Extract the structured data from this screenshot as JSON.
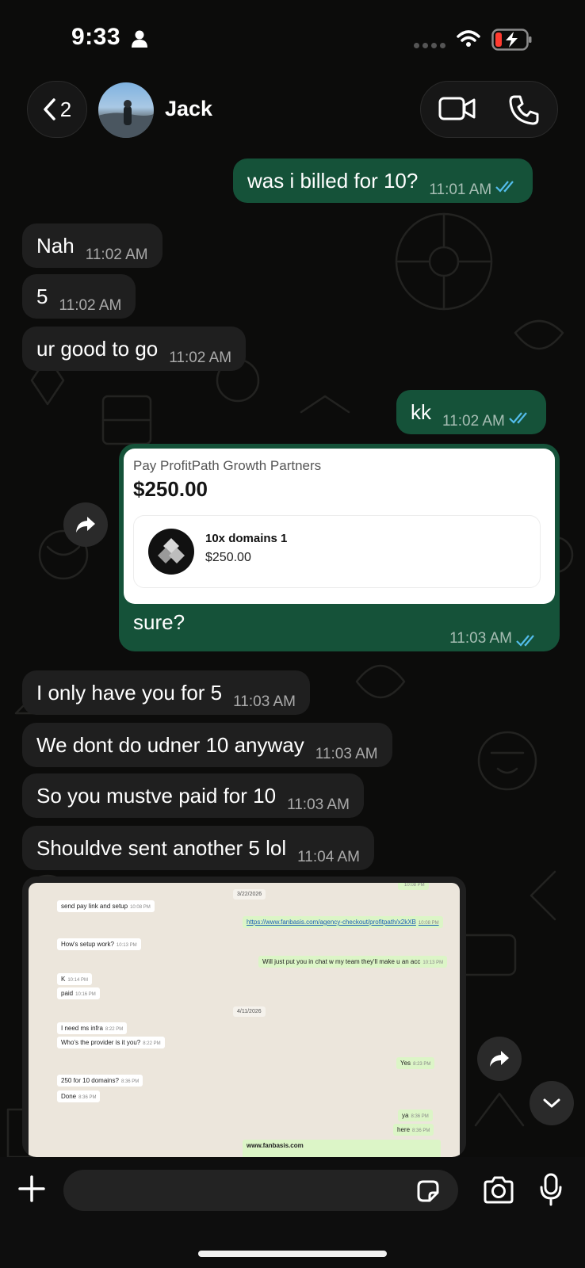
{
  "status_bar": {
    "time": "9:33"
  },
  "header": {
    "back_count": "2",
    "contact_name": "Jack"
  },
  "messages": [
    {
      "dir": "out",
      "text": "was i billed for 10?",
      "time": "11:01 AM"
    },
    {
      "dir": "in",
      "text": "Nah",
      "time": "11:02 AM"
    },
    {
      "dir": "in",
      "text": "5",
      "time": "11:02 AM"
    },
    {
      "dir": "in",
      "text": "ur good to go",
      "time": "11:02 AM"
    },
    {
      "dir": "out",
      "text": "kk",
      "time": "11:02 AM"
    },
    {
      "dir": "in",
      "text": "I only have you for 5",
      "time": "11:03 AM"
    },
    {
      "dir": "in",
      "text": "We dont do udner 10 anyway",
      "time": "11:03 AM"
    },
    {
      "dir": "in",
      "text": "So you mustve paid for 10",
      "time": "11:03 AM"
    },
    {
      "dir": "in",
      "text": "Shouldve sent another 5 lol",
      "time": "11:04 AM"
    }
  ],
  "payment": {
    "merchant": "Pay ProfitPath Growth Partners",
    "amount": "$250.00",
    "item_name": "10x domains 1",
    "item_price": "$250.00",
    "caption": "sure?",
    "time": "11:03 AM"
  },
  "screenshot": {
    "d1": "3/22/2026",
    "top_time": "10:08 PM",
    "m1": "send pay link and setup",
    "m1t": "10:08 PM",
    "link": "https://www.fanbasis.com/agency-checkout/profitpath/x2kXB",
    "linkt": "10:08 PM",
    "m2": "How's setup work?",
    "m2t": "10:13 PM",
    "m3": "Will just put you in chat w my team they'll make u an acc",
    "m3t": "10:13 PM",
    "m4": "K",
    "m4t": "10:14 PM",
    "m5": "paid",
    "m5t": "10:16 PM",
    "d2": "4/11/2026",
    "m6": "I need ms infra",
    "m6t": "8:22 PM",
    "m7": "Who's the provider is it you?",
    "m7t": "8:22 PM",
    "m8": "Yes",
    "m8t": "8:23 PM",
    "m9": "250 for 10 domains?",
    "m9t": "8:36 PM",
    "m10": "Done",
    "m10t": "8:36 PM",
    "m11": "ya",
    "m11t": "8:36 PM",
    "m12": "here",
    "m12t": "8:36 PM",
    "m13": "www.fanbasis.com"
  },
  "composer": {
    "placeholder": ""
  },
  "colors": {
    "outgoing": "#155239",
    "incoming": "#1f1f1f",
    "tick_blue": "#53bdeb"
  }
}
